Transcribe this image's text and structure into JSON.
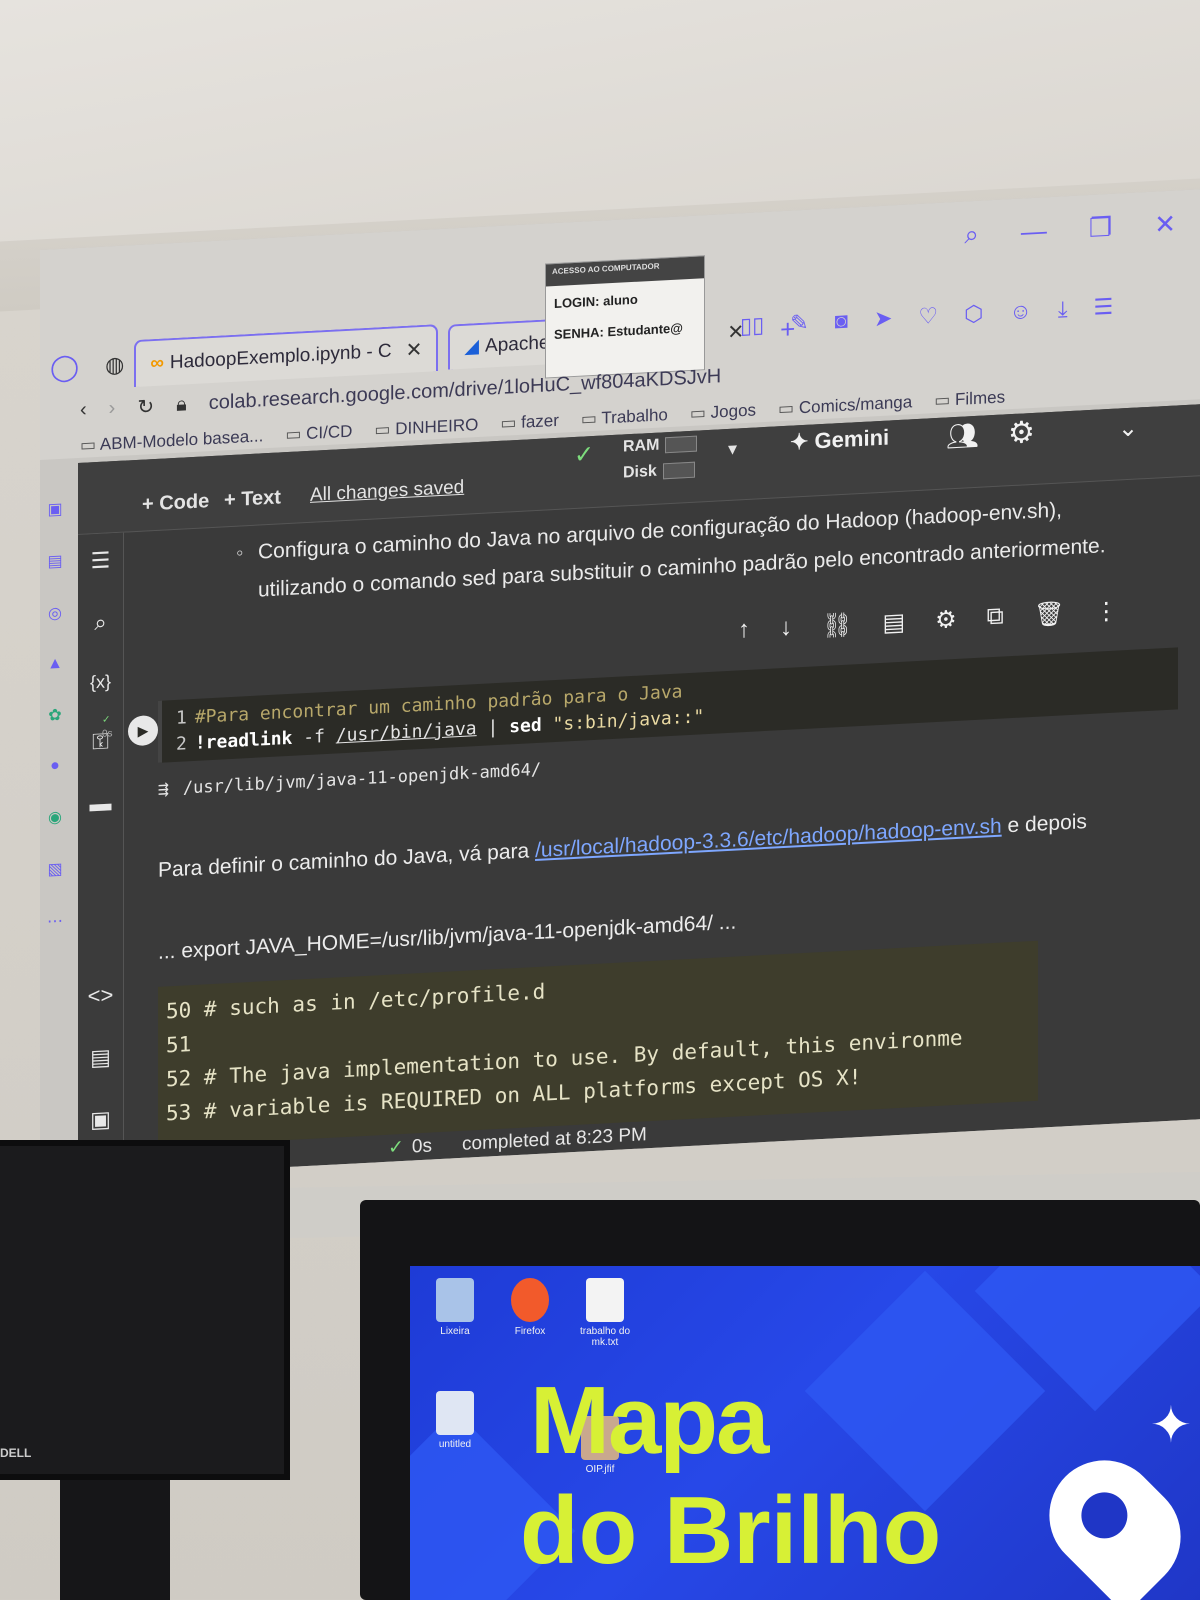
{
  "window": {
    "tabs": [
      {
        "label": "HadoopExemplo.ipynb - C",
        "icon": "colab-icon"
      },
      {
        "label": "Apache Hadoop",
        "icon": "hadoop-icon"
      }
    ],
    "address": "colab.research.google.com/drive/1loHuC_wf804aKDSJvH",
    "bookmarks": [
      "ABM-Modelo basea...",
      "CI/CD",
      "DINHEIRO",
      "fazer",
      "Trabalho",
      "Jogos",
      "Comics/manga",
      "Filmes"
    ],
    "sticky_note": {
      "header": "ACESSO AO COMPUTADOR",
      "login": "LOGIN: aluno",
      "senha": "SENHA: Estudante@"
    }
  },
  "colab": {
    "toolbar": {
      "add_code": "+ Code",
      "add_text": "+ Text",
      "saved": "All changes saved",
      "ram": "RAM",
      "disk": "Disk",
      "gemini": "Gemini"
    },
    "markdown_bullet": "Configura o caminho do Java no arquivo de configuração do Hadoop (hadoop-env.sh), utilizando o comando sed para substituir o caminho padrão pelo encontrado anteriormente.",
    "cell": {
      "exec_time": "0s",
      "line1_num": "1",
      "line1": "#Para encontrar um caminho padrão para o Java",
      "line2_num": "2",
      "line2_cmd": "!readlink",
      "line2_flag": "-f",
      "line2_path": "/usr/bin/java",
      "line2_pipe": "|",
      "line2_sed": "sed",
      "line2_str": "\"s:bin/java::\""
    },
    "output": "/usr/lib/jvm/java-11-openjdk-amd64/",
    "para": {
      "prefix": "Para definir o caminho do Java, vá para",
      "link": "/usr/local/hadoop-3.3.6/etc/hadoop/hadoop-env.sh",
      "suffix": "e depois"
    },
    "export_line": "... export JAVA_HOME=/usr/lib/jvm/java-11-openjdk-amd64/ ...",
    "file_lines": [
      "50 # such as in /etc/profile.d",
      "51",
      "52 # The java implementation to use. By default, this environme",
      "53 # variable is REQUIRED on ALL platforms except OS X!"
    ],
    "status": {
      "time": "0s",
      "completed": "completed at 8:23 PM"
    }
  },
  "desktop": {
    "icons": [
      "Lixeira",
      "Firefox",
      "trabalho do mk.txt",
      "untitled",
      "OIP.jfif"
    ],
    "title_line1": "Mapa",
    "title_line2": "do Brilho"
  },
  "monitor_brand": "DELL"
}
